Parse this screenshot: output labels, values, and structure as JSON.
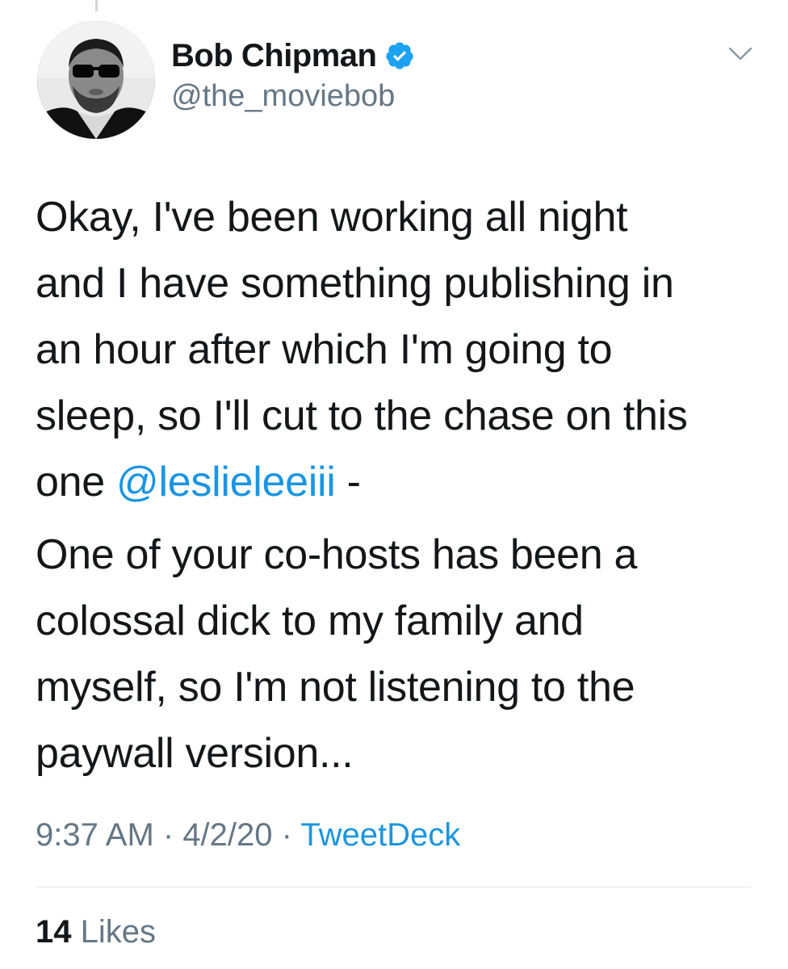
{
  "author": {
    "display_name": "Bob Chipman",
    "handle": "@the_moviebob",
    "verified": true,
    "avatar": "profile-photo-man-sunglasses-beard"
  },
  "menu_icon": "chevron-down-icon",
  "tweet": {
    "lines": [
      "Okay, I've been working all night",
      "and I have something publishing in",
      "an hour after which I'm going to",
      "sleep, so I'll cut to the chase on this"
    ],
    "last_line_prefix": "one ",
    "mention": "@leslieleeiii",
    "last_line_suffix": " -",
    "lines2": [
      "One of your co-hosts has been a",
      "colossal dick to my family and",
      "myself, so I'm not listening to the",
      "paywall version..."
    ]
  },
  "meta": {
    "time": "9:37 AM",
    "separator": " · ",
    "date": "4/2/20",
    "source": "TweetDeck"
  },
  "stats": {
    "likes_count": "14",
    "likes_label": "Likes"
  },
  "colors": {
    "link": "#1b95e0",
    "secondary_text": "#657786",
    "primary_text": "#14171a",
    "verified_badge": "#1da1f2"
  }
}
